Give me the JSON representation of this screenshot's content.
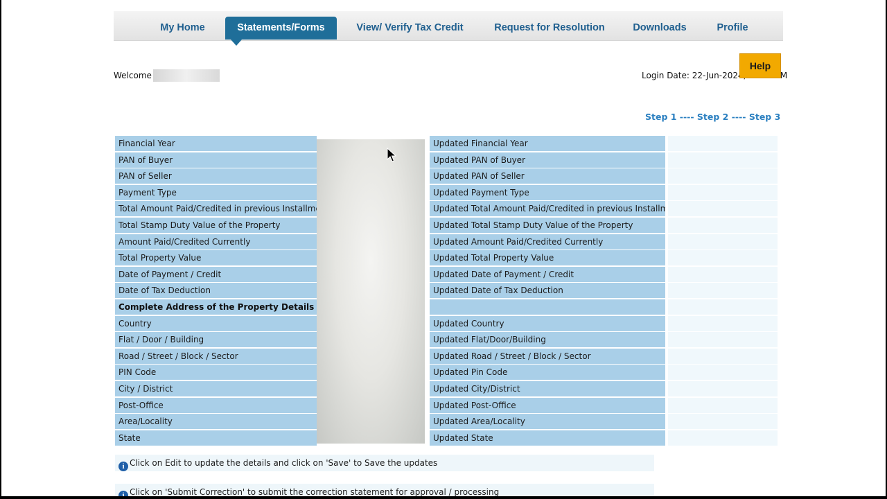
{
  "nav": {
    "tabs": [
      {
        "label": "My Home",
        "active": false
      },
      {
        "label": "Statements/Forms",
        "active": true
      },
      {
        "label": "View/ Verify Tax Credit",
        "active": false
      },
      {
        "label": "Request for Resolution",
        "active": false
      },
      {
        "label": "Downloads",
        "active": false
      },
      {
        "label": "Profile",
        "active": false
      }
    ]
  },
  "help_label": "Help",
  "welcome": "Welcome A",
  "login": "Login Date: 22-Jun-2024, 04:07 PM",
  "steps": {
    "step1": "Step 1",
    "sep1": " ---- ",
    "step2": "Step 2",
    "sep2": " ---- ",
    "step3": "Step 3"
  },
  "rows": [
    {
      "left": "Financial Year",
      "right": "Updated Financial Year"
    },
    {
      "left": "PAN of Buyer",
      "right": "Updated PAN of Buyer"
    },
    {
      "left": "PAN of Seller",
      "right": "Updated PAN of Seller"
    },
    {
      "left": "Payment Type",
      "right": "Updated Payment Type"
    },
    {
      "left": "Total Amount Paid/Credited in previous Installments",
      "right": "Updated Total Amount Paid/Credited in previous Installments"
    },
    {
      "left": "Total Stamp Duty Value of the Property",
      "right": "Updated Total Stamp Duty Value of the Property"
    },
    {
      "left": "Amount Paid/Credited Currently",
      "right": "Updated Amount Paid/Credited Currently"
    },
    {
      "left": "Total Property Value",
      "right": "Updated Total Property Value"
    },
    {
      "left": "Date of Payment / Credit",
      "right": "Updated Date of Payment / Credit"
    },
    {
      "left": "Date of Tax Deduction",
      "right": "Updated Date of Tax Deduction"
    },
    {
      "left": "Complete Address of the Property Details",
      "right": "",
      "bold": true
    },
    {
      "left": "Country",
      "right": "Updated Country"
    },
    {
      "left": "Flat / Door / Building",
      "right": "Updated Flat/Door/Building"
    },
    {
      "left": "Road / Street / Block / Sector",
      "right": "Updated Road / Street / Block / Sector"
    },
    {
      "left": "PIN Code",
      "right": "Updated Pin Code"
    },
    {
      "left": "City / District",
      "right": "Updated City/District"
    },
    {
      "left": "Post-Office",
      "right": "Updated Post-Office"
    },
    {
      "left": "Area/Locality",
      "right": "Updated Area/Locality"
    },
    {
      "left": "State",
      "right": "Updated State"
    }
  ],
  "notes": [
    "Click on Edit to update the details and click on 'Save' to Save the updates",
    "Click on 'Submit Correction' to submit the correction statement for approval / processing"
  ],
  "colors": {
    "accent": "#1f6e99",
    "cell": "#a9cfe8",
    "help": "#f2a900"
  }
}
